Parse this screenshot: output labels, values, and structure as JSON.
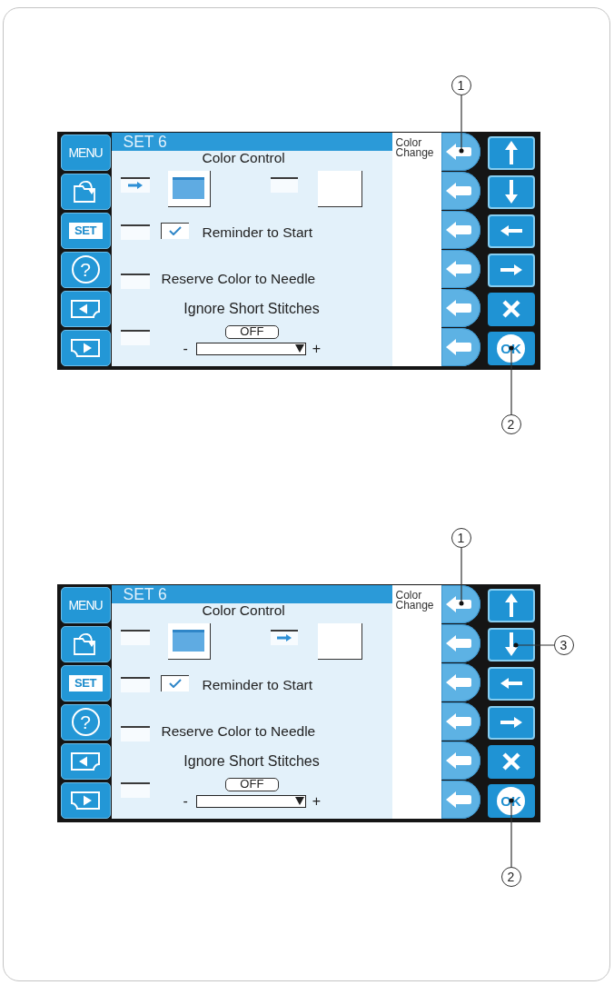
{
  "figures": [
    {
      "screen": {
        "sidebar": [
          {
            "kind": "menu",
            "label": "MENU"
          },
          {
            "kind": "load"
          },
          {
            "kind": "set",
            "label": "SET"
          },
          {
            "kind": "help",
            "label": "?"
          },
          {
            "kind": "back"
          },
          {
            "kind": "forward"
          }
        ],
        "header": "SET 6",
        "title": "Color Control",
        "color_options": [
          {
            "kind": "swatch",
            "selected": true
          },
          {
            "kind": "blank",
            "selected": false
          }
        ],
        "reminder": {
          "label": "Reminder to Start",
          "checked": true,
          "selected": false
        },
        "reserve": {
          "label": "Reserve Color to Needle",
          "selected": false
        },
        "ignore": {
          "label": "Ignore Short Stitches",
          "value": "OFF",
          "minus": "-",
          "plus": "+",
          "selected": false
        },
        "side_label": "Color Change",
        "row_buttons": [
          {
            "kind": "arrow"
          },
          {
            "kind": "arrow"
          },
          {
            "kind": "arrow"
          },
          {
            "kind": "arrow"
          },
          {
            "kind": "arrow"
          },
          {
            "kind": "arrow"
          }
        ],
        "nav_buttons": [
          {
            "kind": "up"
          },
          {
            "kind": "down"
          },
          {
            "kind": "left"
          },
          {
            "kind": "right"
          },
          {
            "kind": "cancel"
          },
          {
            "kind": "ok",
            "label": "OK"
          }
        ]
      },
      "callouts": [
        {
          "number": "1",
          "kind": "above"
        },
        {
          "number": "2",
          "kind": "below"
        }
      ]
    },
    {
      "screen": {
        "sidebar": [
          {
            "kind": "menu",
            "label": "MENU"
          },
          {
            "kind": "load"
          },
          {
            "kind": "set",
            "label": "SET"
          },
          {
            "kind": "help",
            "label": "?"
          },
          {
            "kind": "back"
          },
          {
            "kind": "forward"
          }
        ],
        "header": "SET 6",
        "title": "Color Control",
        "color_options": [
          {
            "kind": "swatch",
            "selected": false
          },
          {
            "kind": "blank",
            "selected": true
          }
        ],
        "reminder": {
          "label": "Reminder to Start",
          "checked": true,
          "selected": false
        },
        "reserve": {
          "label": "Reserve Color to Needle",
          "selected": false
        },
        "ignore": {
          "label": "Ignore Short Stitches",
          "value": "OFF",
          "minus": "-",
          "plus": "+",
          "selected": false
        },
        "side_label": "Color Change",
        "row_buttons": [
          {
            "kind": "arrow"
          },
          {
            "kind": "arrow"
          },
          {
            "kind": "arrow"
          },
          {
            "kind": "arrow"
          },
          {
            "kind": "arrow"
          },
          {
            "kind": "arrow"
          }
        ],
        "nav_buttons": [
          {
            "kind": "up"
          },
          {
            "kind": "down"
          },
          {
            "kind": "left"
          },
          {
            "kind": "right"
          },
          {
            "kind": "cancel"
          },
          {
            "kind": "ok",
            "label": "OK"
          }
        ]
      },
      "callouts": [
        {
          "number": "1",
          "kind": "above"
        },
        {
          "number": "3",
          "kind": "right"
        },
        {
          "number": "2",
          "kind": "below"
        }
      ]
    }
  ]
}
